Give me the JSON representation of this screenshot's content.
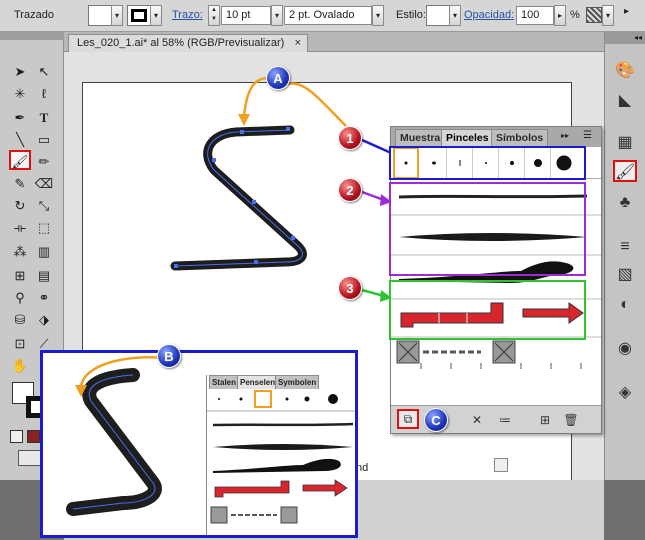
{
  "control_bar": {
    "label": "Trazado",
    "stroke_label": "Trazo:",
    "stroke_value": "10 pt",
    "profile_value": "2 pt. Ovalado",
    "style_label": "Estilo:",
    "opacity_label": "Opacidad:",
    "opacity_value": "100",
    "percent": "%"
  },
  "document": {
    "tab_title": "Les_020_1.ai* al 58% (RGB/Previsualizar)",
    "tab_close": "×"
  },
  "brushes_panel": {
    "tabs": [
      "Muestras",
      "Pinceles",
      "Símbolos"
    ],
    "menu_glyph": "▸▸",
    "status_fragment": "nd"
  },
  "inset_panel": {
    "tabs": [
      "Stalen",
      "Penselen",
      "Symbolen"
    ]
  },
  "markers": {
    "a": "A",
    "b": "B",
    "c": "C",
    "one": "1",
    "two": "2",
    "three": "3"
  },
  "colors": {
    "marker_blue": "#1d34b9",
    "marker_red": "#b3121e",
    "arrow_orange": "#f0a020",
    "arrow_blue": "#1c1ccd",
    "arrow_purple": "#9b2bd6",
    "arrow_green": "#2fc42f",
    "highlight_red": "#e01010",
    "art_brush_red": "#d9262e"
  }
}
